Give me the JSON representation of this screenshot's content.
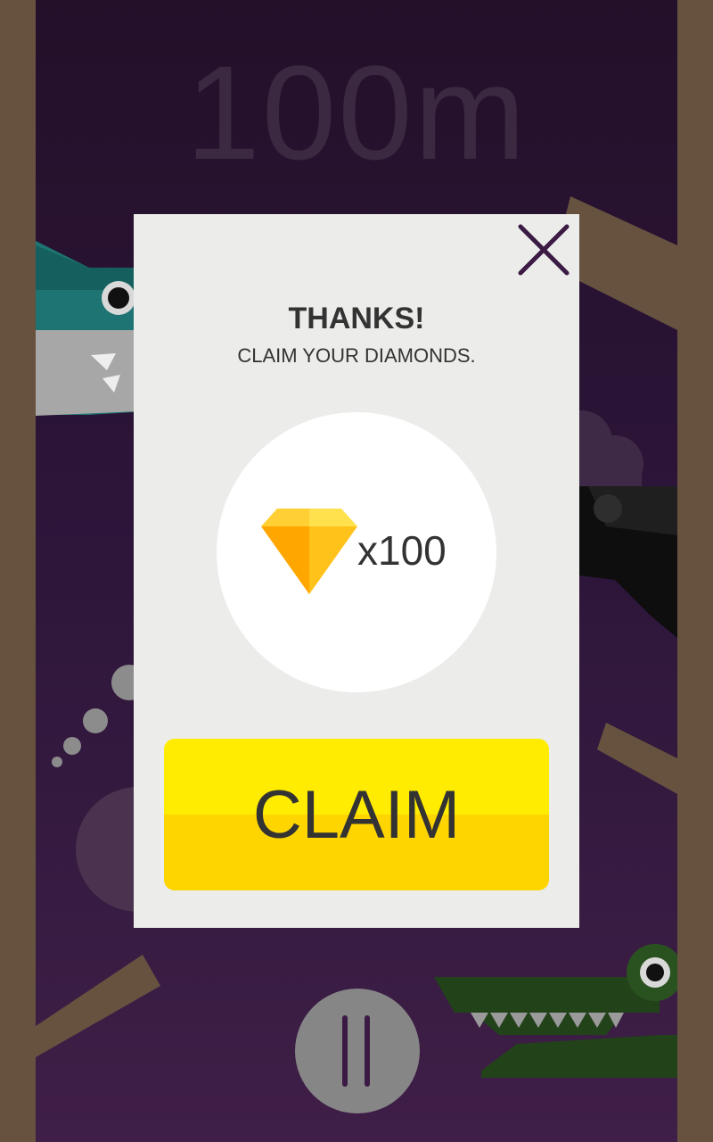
{
  "hud": {
    "distance": "100m"
  },
  "modal": {
    "close_icon": "close-icon",
    "title": "THANKS!",
    "subtitle": "CLAIM YOUR DIAMONDS.",
    "reward": {
      "icon": "diamond-icon",
      "amount": "x100"
    },
    "claim_label": "CLAIM"
  },
  "controls": {
    "pause_icon": "pause-icon"
  },
  "colors": {
    "wall": "#66523f",
    "background_top": "#241029",
    "background_bottom": "#3f1f47",
    "modal": "#ececea",
    "button_top": "#ffec00",
    "button_bottom": "#ffd500",
    "text": "#333333",
    "pause_button": "#868686"
  }
}
